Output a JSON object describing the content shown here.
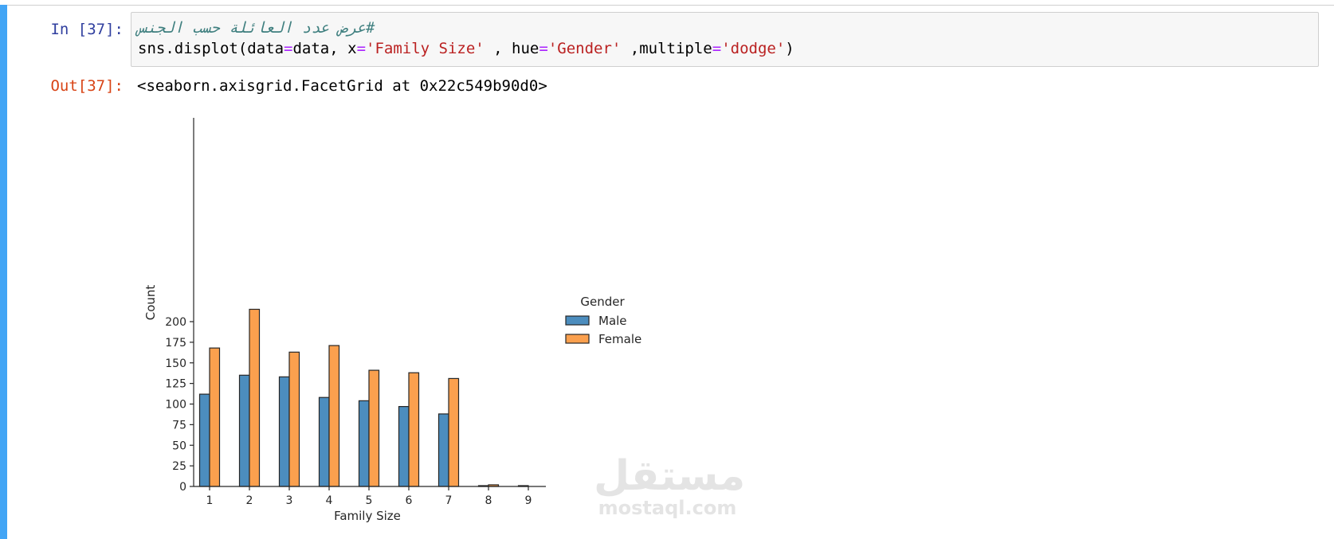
{
  "cell": {
    "in_prompt": "In [37]:",
    "out_prompt": "Out[37]:",
    "code_line1": "عرض عدد العائلة حسب الجنس#",
    "code_line2": {
      "t1": "sns.displot(data",
      "t2": "=",
      "t3": "data, x",
      "t4": "=",
      "t5": "'Family Size'",
      "t6": " , hue",
      "t7": "=",
      "t8": "'Gender'",
      "t9": " ,multiple",
      "t10": "=",
      "t11": "'dodge'",
      "t12": ")"
    },
    "output_text": "<seaborn.axisgrid.FacetGrid at 0x22c549b90d0>"
  },
  "watermark": {
    "arabic": "مستقل",
    "latin": "mostaql.com"
  },
  "colors": {
    "male": "#4c8dbe",
    "female": "#fba04e",
    "accent": "#42a5f5"
  },
  "chart_data": {
    "type": "bar",
    "categories": [
      "1",
      "2",
      "3",
      "4",
      "5",
      "6",
      "7",
      "8",
      "9"
    ],
    "series": [
      {
        "name": "Male",
        "values": [
          112,
          135,
          133,
          108,
          104,
          97,
          88,
          1,
          1
        ]
      },
      {
        "name": "Female",
        "values": [
          168,
          215,
          163,
          171,
          141,
          138,
          131,
          2,
          0
        ]
      }
    ],
    "xlabel": "Family Size",
    "ylabel": "Count",
    "yticks": [
      "0",
      "25",
      "50",
      "75",
      "100",
      "125",
      "150",
      "175",
      "200"
    ],
    "ylim": [
      0,
      225
    ],
    "legend_title": "Gender",
    "legend_position": "right"
  }
}
